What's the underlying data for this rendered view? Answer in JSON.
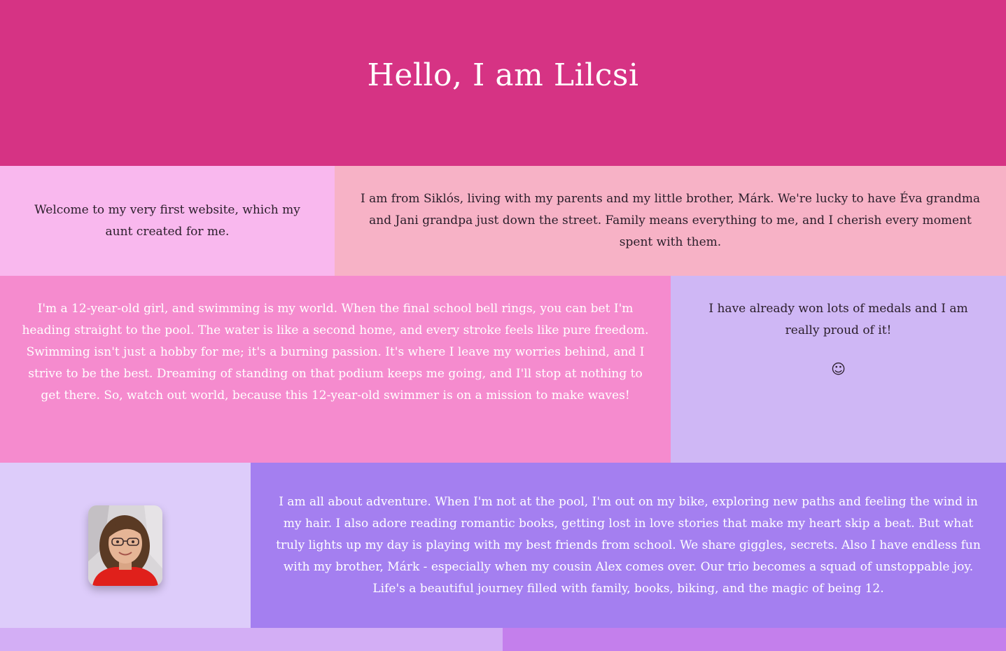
{
  "page": {
    "title": "Hello, I am Lilcsi"
  },
  "colors": {
    "header_bg": "#d63384",
    "welcome_bg": "#f9b8ee",
    "family_bg": "#f7b2c6",
    "swim_bg": "#f58bce",
    "medals_bg": "#cfb7f5",
    "photo_bg": "#ddccfa",
    "adventure_bg": "#a47ff0",
    "strip_left_bg": "#d3aef5",
    "strip_right_bg": "#c47fec"
  },
  "sections": {
    "welcome": "Welcome to my very first website, which my aunt created for me.",
    "family": "I am from Siklós, living with my parents and my little brother, Márk. We're lucky to have Éva grandma and Jani grandpa just down the street. Family means everything to me, and I cherish every moment spent with them.",
    "swimming": "I'm a 12-year-old girl, and swimming is my world. When the final school bell rings, you can bet I'm heading straight to the pool. The water is like a second home, and every stroke feels like pure freedom. Swimming isn't just a hobby for me; it's a burning passion. It's where I leave my worries behind, and I strive to be the best. Dreaming of standing on that podium keeps me going, and I'll stop at nothing to get there. So, watch out world, because this 12-year-old swimmer is on a mission to make waves!",
    "medals": "I have already won lots of medals and I am really proud of it!",
    "medals_emoji": "☺",
    "adventure": "I am all about adventure. When I'm not at the pool, I'm out on my bike, exploring new paths and feeling the wind in my hair. I also adore reading romantic books, getting lost in love stories that make my heart skip a beat. But what truly lights up my day is playing with my best friends from school. We share giggles, secrets. Also I have endless fun with my brother, Márk - especially when my cousin Alex comes over. Our trio becomes a squad of unstoppable joy. Life's a beautiful journey filled with family, books, biking, and the magic of being 12."
  },
  "photo": {
    "icon": "portrait-photo"
  }
}
